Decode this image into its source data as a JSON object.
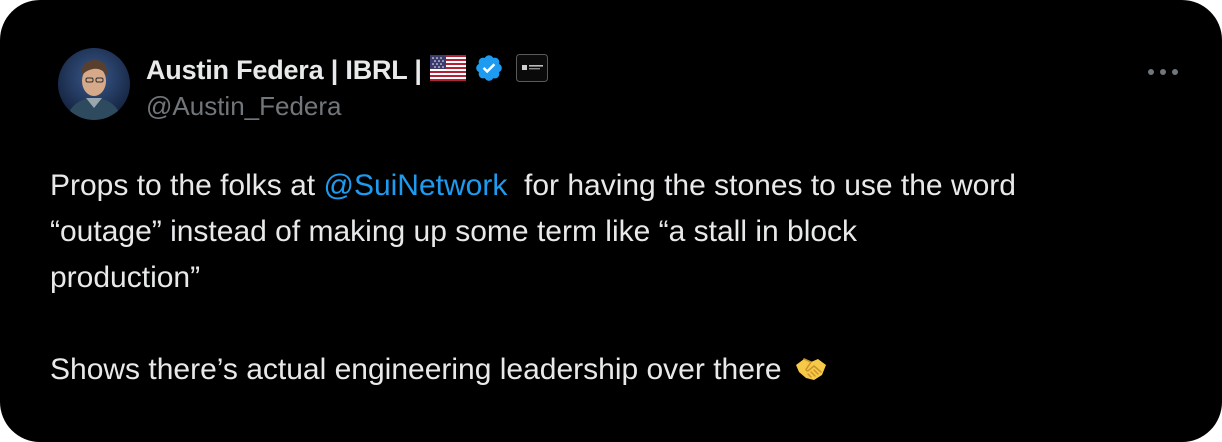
{
  "author": {
    "display_name": "Austin Federa | IBRL |",
    "handle": "@Austin_Federa",
    "flag_icon": "us-flag-icon",
    "verified_icon": "verified-badge-icon",
    "verified_color": "#1d9bf0",
    "org_badge_icon": "org-badge-icon"
  },
  "tweet": {
    "line1_prefix": "Props to the folks at ",
    "mention": "@SuiNetwork",
    "line1_suffix": "  for having the stones to use the word",
    "line2": "“outage” instead of making up some term like “a stall in block",
    "line3": "production”",
    "line4": "Shows there’s actual engineering leadership over there",
    "emoji_icon": "handshake-icon"
  },
  "menu": {
    "more_icon": "more-options-icon"
  },
  "colors": {
    "background": "#000000",
    "text": "#e7e9ea",
    "secondary_text": "#71767b",
    "link": "#1d9bf0"
  }
}
